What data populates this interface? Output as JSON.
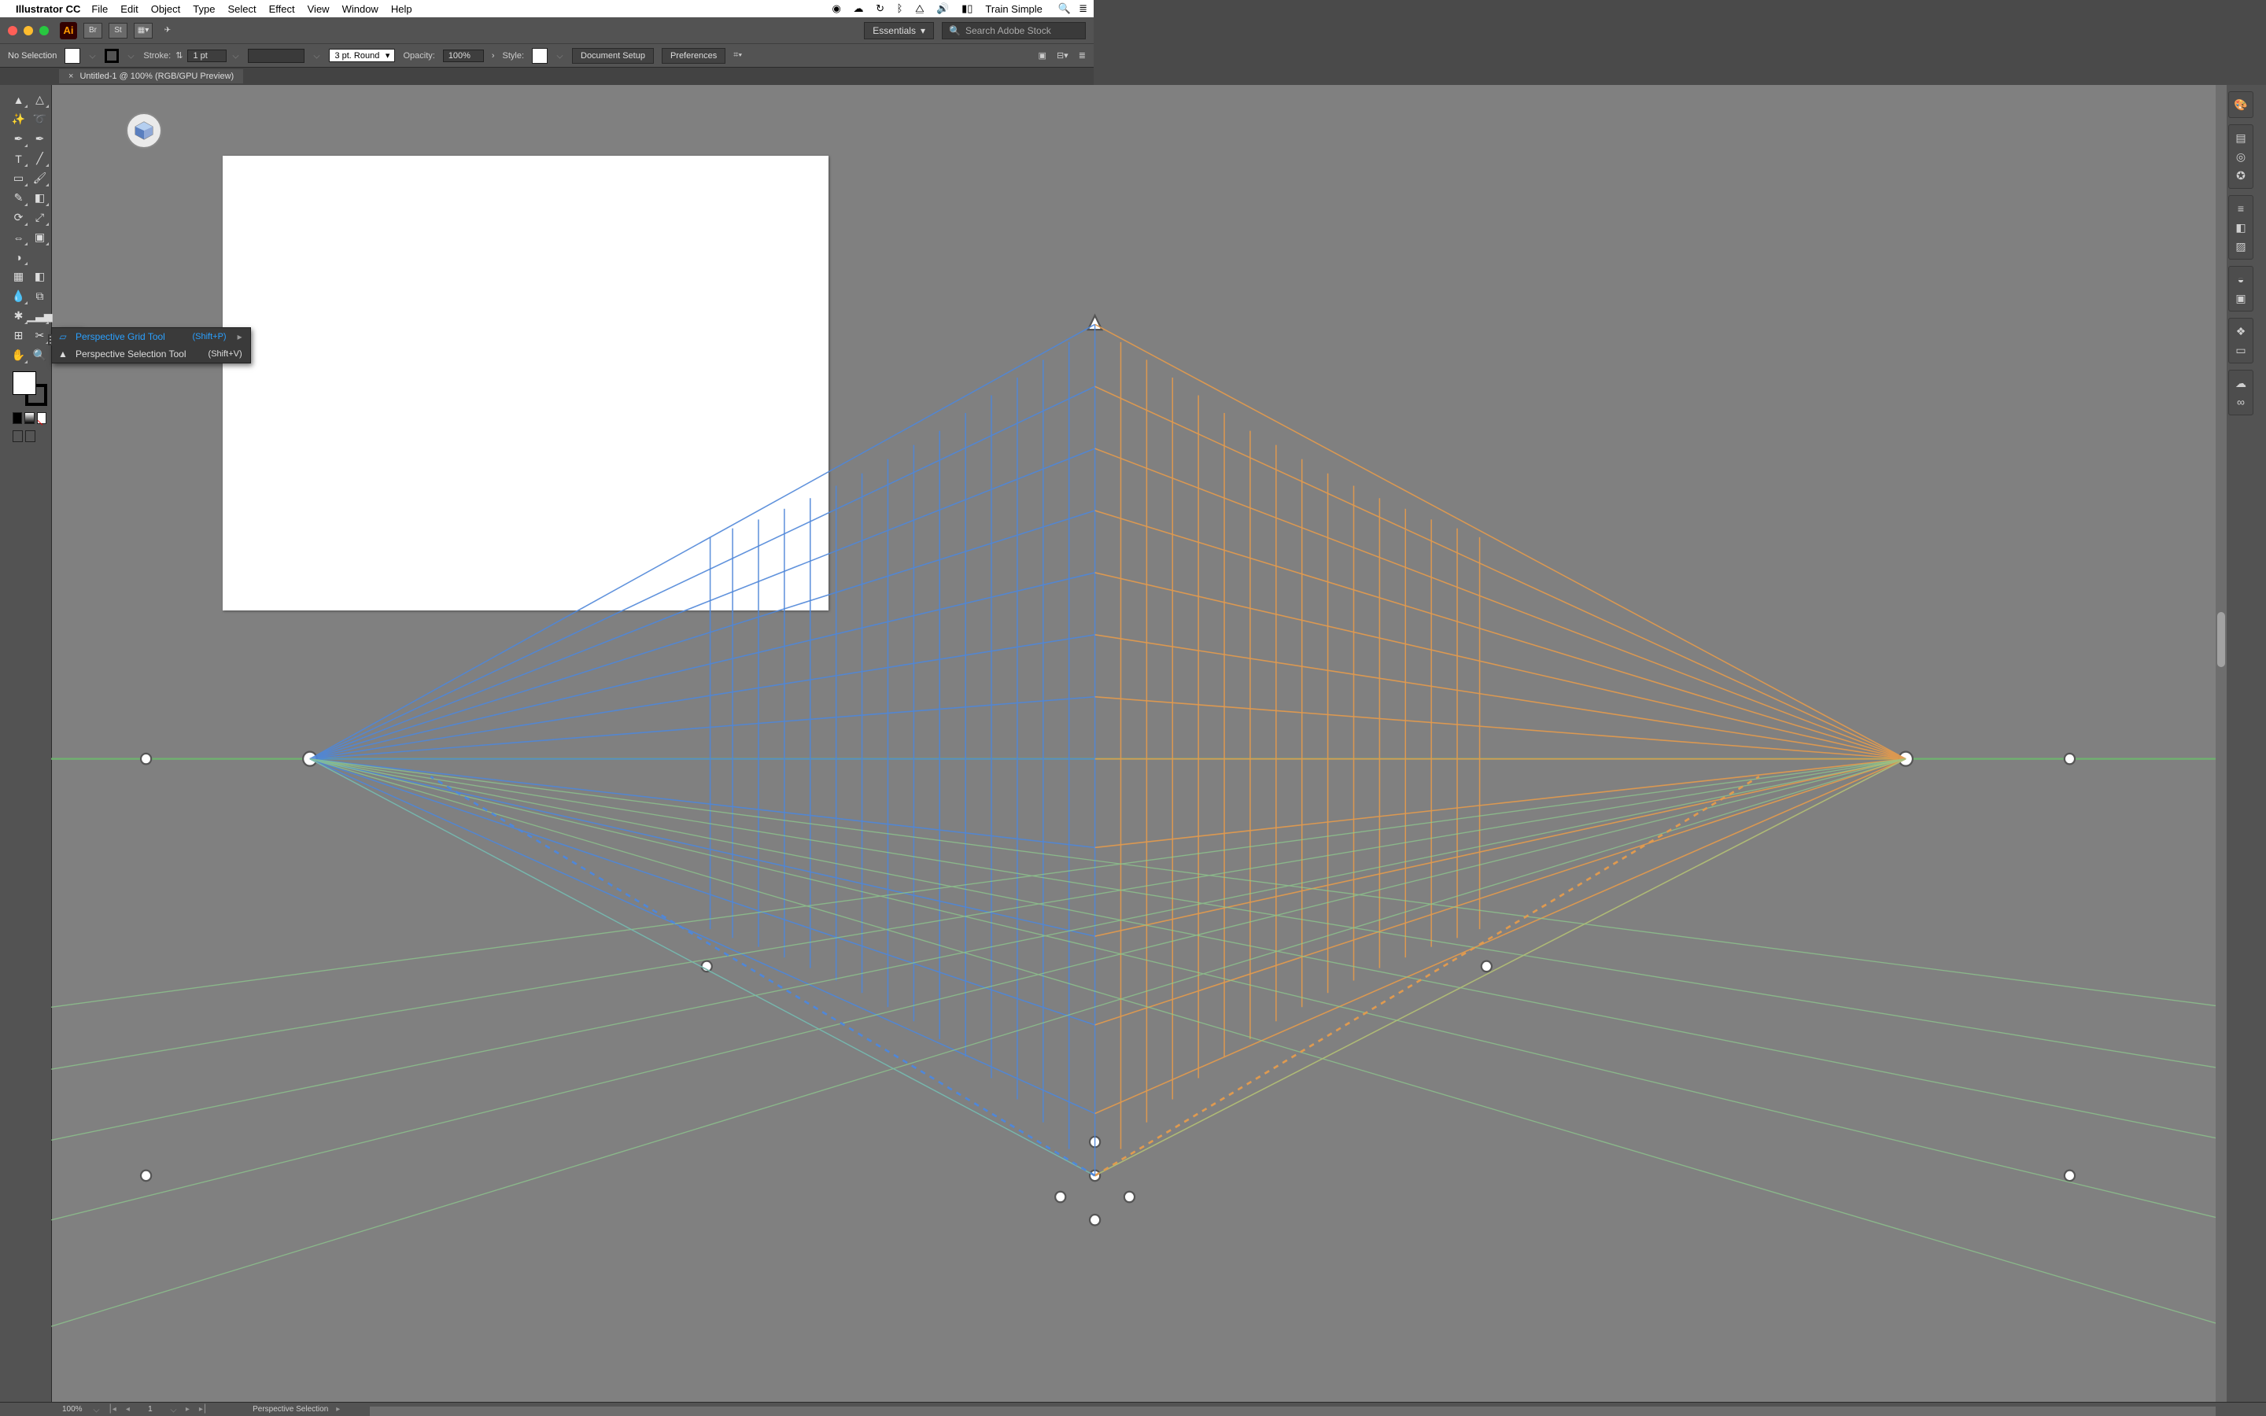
{
  "mac_menu": {
    "app": "Illustrator CC",
    "items": [
      "File",
      "Edit",
      "Object",
      "Type",
      "Select",
      "Effect",
      "View",
      "Window",
      "Help"
    ],
    "user": "Train Simple"
  },
  "titlebar": {
    "workspace": "Essentials",
    "stock_placeholder": "Search Adobe Stock"
  },
  "control_bar": {
    "selection": "No Selection",
    "stroke_label": "Stroke:",
    "stroke_value": "1 pt",
    "point_label": "3 pt. Round",
    "opacity_label": "Opacity:",
    "opacity_value": "100%",
    "style_label": "Style:",
    "doc_setup": "Document Setup",
    "prefs": "Preferences"
  },
  "doc_tab": {
    "title": "Untitled-1 @ 100% (RGB/GPU Preview)"
  },
  "flyout": {
    "items": [
      {
        "label": "Perspective Grid Tool",
        "shortcut": "(Shift+P)",
        "selected": true
      },
      {
        "label": "Perspective Selection Tool",
        "shortcut": "(Shift+V)",
        "selected": false
      }
    ]
  },
  "statusbar": {
    "zoom": "100%",
    "artboard": "1",
    "tool": "Perspective Selection"
  }
}
